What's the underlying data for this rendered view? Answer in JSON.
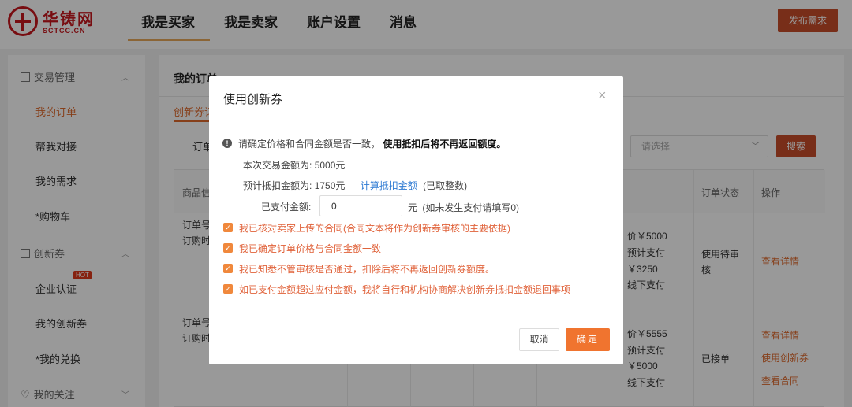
{
  "header": {
    "logo_name": "华铸网",
    "logo_sub": "SCTCC.CN",
    "nav": [
      "我是买家",
      "我是卖家",
      "账户设置",
      "消息"
    ],
    "publish_label": "发布需求"
  },
  "sidebar": {
    "group_trade": "交易管理",
    "trade_items": [
      "我的订单",
      "帮我对接",
      "我的需求",
      "*购物车"
    ],
    "group_voucher": "创新券",
    "voucher_items": [
      "企业认证",
      "我的创新券",
      "*我的兑换"
    ],
    "hot_badge": "HOT",
    "group_follow": "我的关注"
  },
  "main": {
    "title": "我的订单",
    "tab": "创新券订",
    "filter_label": "订单",
    "select_placeholder": "请选择",
    "search_label": "搜索",
    "headers": {
      "goods": "商品信",
      "status": "订单状态",
      "action": "操作"
    },
    "rows": [
      {
        "order_no": "订单号",
        "order_time": "订购时",
        "price_line1": "价￥5000",
        "price_line2": "预计支付",
        "price_line3": "￥3250",
        "price_line4": "线下支付",
        "status_line1": "使用待审",
        "status_line2": "核",
        "actions": [
          "查看详情"
        ]
      },
      {
        "order_no": "订单号",
        "order_time": "订购时",
        "price_line1": "价￥5555",
        "price_line2": "预计支付",
        "price_line3": "￥5000",
        "price_line4": "线下支付",
        "status_line1": "已接单",
        "actions": [
          "查看详情",
          "使用创新券",
          "查看合同"
        ]
      }
    ]
  },
  "modal": {
    "title": "使用创新券",
    "close_icon": "×",
    "notice_plain": "请确定价格和合同金额是否一致，",
    "notice_bold": "使用抵扣后将不再返回额度。",
    "amount_label": "本次交易金额为:",
    "amount_value": "5000元",
    "deduct_label": "预计抵扣金额为:",
    "deduct_value": "1750元",
    "calc_link": "计算抵扣金额",
    "deduct_note": "(已取整数)",
    "paid_label": "已支付金额:",
    "paid_value": "0",
    "paid_unit": "元",
    "paid_note": "(如未发生支付请填写0)",
    "checks": [
      "我已核对卖家上传的合同(合同文本将作为创新券审核的主要依据)",
      "我已确定订单价格与合同金额一致",
      "我已知悉不管审核是否通过，扣除后将不再返回创新券额度。",
      "如已支付金额超过应付金额，我将自行和机构协商解决创新券抵扣金额退回事项"
    ],
    "cancel_label": "取消",
    "ok_label": "确定"
  }
}
